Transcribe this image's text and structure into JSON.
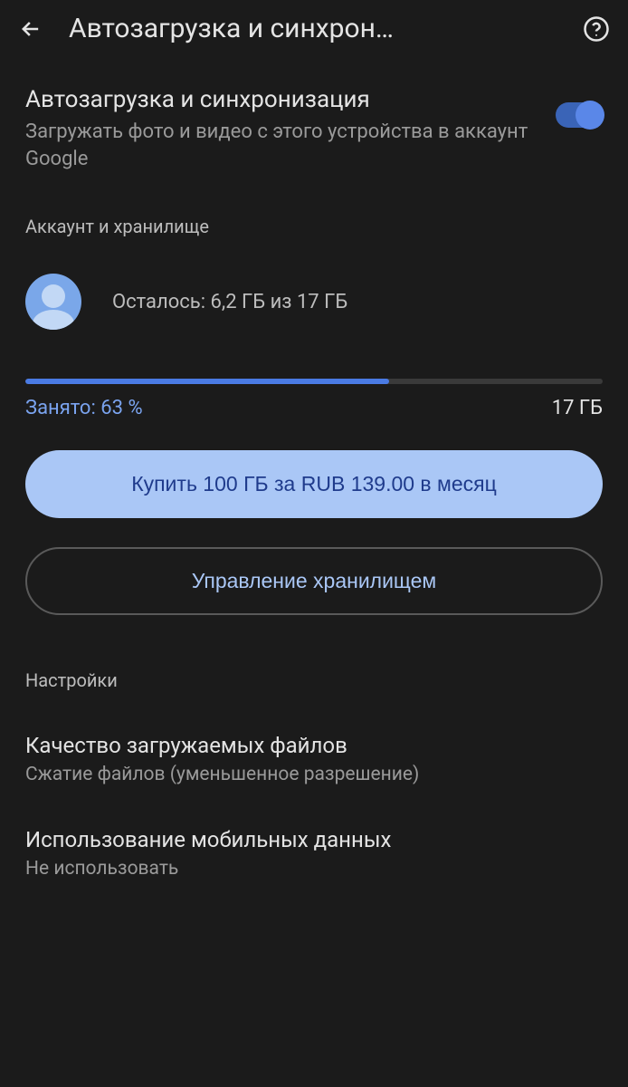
{
  "header": {
    "title": "Автозагрузка и синхрон…"
  },
  "sync": {
    "title": "Автозагрузка и синхронизация",
    "sub": "Загружать фото и видео с этого устройства в аккаунт Google"
  },
  "account_section": {
    "label": "Аккаунт и хранилище",
    "storage_remaining": "Осталось: 6,2 ГБ из 17 ГБ",
    "used_label": "Занято: 63 %",
    "used_percent": 63,
    "total": "17 ГБ"
  },
  "buttons": {
    "buy": "Купить 100 ГБ за RUB 139.00 в месяц",
    "manage": "Управление хранилищем"
  },
  "settings": {
    "label": "Настройки",
    "items": [
      {
        "title": "Качество загружаемых файлов",
        "sub": "Сжатие файлов (уменьшенное разрешение)"
      },
      {
        "title": "Использование мобильных данных",
        "sub": "Не использовать"
      }
    ]
  }
}
